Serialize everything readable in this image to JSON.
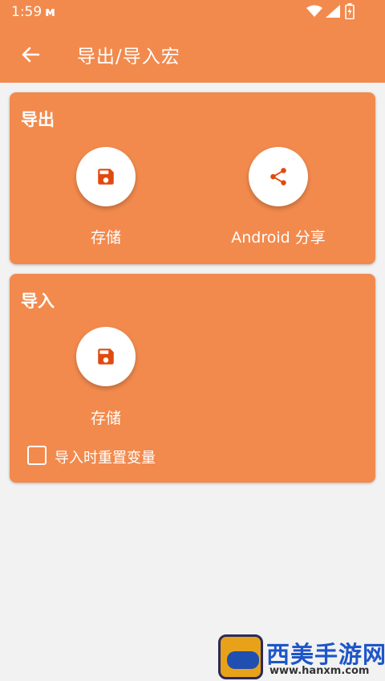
{
  "status_bar": {
    "time": "1:59",
    "notification_icon": "app-notification-icon",
    "wifi_icon": "wifi-icon",
    "signal_icon": "signal-icon",
    "battery_icon": "battery-icon"
  },
  "app_bar": {
    "back_icon": "arrow-left-icon",
    "title": "导出/导入宏"
  },
  "export_card": {
    "title": "导出",
    "save_label": "存储",
    "share_label": "Android 分享",
    "save_icon": "floppy-disk-icon",
    "share_icon": "share-icon"
  },
  "import_card": {
    "title": "导入",
    "save_label": "存储",
    "save_icon": "floppy-disk-icon",
    "checkbox_label": "导入时重置变量",
    "checkbox_checked": false
  },
  "watermark": {
    "name": "西美手游网",
    "url": "www.hanxm.com"
  },
  "colors": {
    "primary": "#f28a4d",
    "icon": "#e04a0e",
    "background": "#f2f2f2",
    "on_primary": "#ffffff"
  }
}
